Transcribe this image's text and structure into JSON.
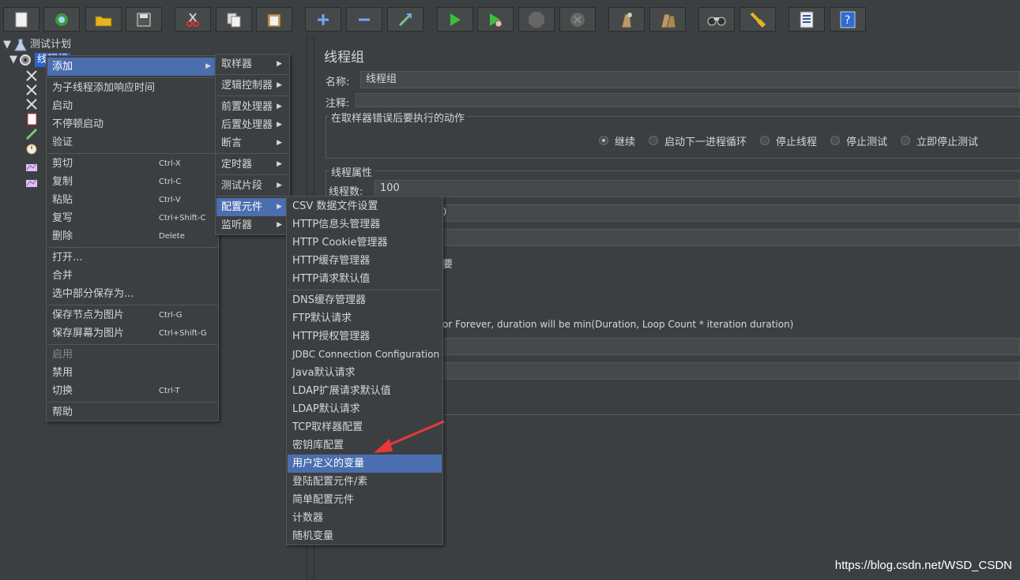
{
  "colors": {
    "bg": "#3c3f41",
    "highlight": "#4b6eaf",
    "tree_selected": "#2f65ca",
    "arrow": "#e8393a"
  },
  "toolbar": {
    "icons": [
      "new-icon",
      "templates-icon",
      "open-icon",
      "save-icon",
      "cut-icon",
      "copy-icon",
      "paste-icon",
      "expand-icon",
      "collapse-icon",
      "toggle-icon",
      "start-icon",
      "start-no-pause-icon",
      "stop-icon",
      "shutdown-icon",
      "clear-icon",
      "clear-all-icon",
      "search-icon",
      "reset-search-icon",
      "function-helper-icon",
      "help-icon"
    ]
  },
  "tree": {
    "test_plan": "测试计划",
    "thread_group": "线程组"
  },
  "panel": {
    "title": "线程组",
    "name_label": "名称:",
    "name_value": "线程组",
    "comment_label": "注释:",
    "error_group_title": "在取样器错误后要执行的动作",
    "error_options": [
      "继续",
      "启动下一进程循环",
      "停止线程",
      "停止测试",
      "立即停止测试"
    ],
    "thread_props_title": "线程属性",
    "threads_label": "线程数:",
    "threads_value": "100",
    "ramp_fragment": "0",
    "same_user_fragment": "要",
    "duration_note": "or Forever, duration will be min(Duration, Loop Count * iteration duration)"
  },
  "context_menu": {
    "items": [
      {
        "label": "添加",
        "arrow": "▶"
      },
      {
        "label": "为子线程添加响应时间"
      },
      {
        "label": "启动"
      },
      {
        "label": "不停顿启动"
      },
      {
        "label": "验证"
      },
      {
        "label": "剪切",
        "shortcut": "Ctrl-X"
      },
      {
        "label": "复制",
        "shortcut": "Ctrl-C"
      },
      {
        "label": "粘贴",
        "shortcut": "Ctrl-V"
      },
      {
        "label": "复写",
        "shortcut": "Ctrl+Shift-C"
      },
      {
        "label": "删除",
        "shortcut": "Delete"
      },
      {
        "label": "打开..."
      },
      {
        "label": "合并"
      },
      {
        "label": "选中部分保存为..."
      },
      {
        "label": "保存节点为图片",
        "shortcut": "Ctrl-G"
      },
      {
        "label": "保存屏幕为图片",
        "shortcut": "Ctrl+Shift-G"
      },
      {
        "label": "启用"
      },
      {
        "label": "禁用"
      },
      {
        "label": "切换",
        "shortcut": "Ctrl-T"
      },
      {
        "label": "帮助"
      }
    ]
  },
  "add_menu": {
    "items": [
      "取样器",
      "逻辑控制器",
      "前置处理器",
      "后置处理器",
      "断言",
      "定时器",
      "测试片段",
      "配置元件",
      "监听器"
    ],
    "arrow": "▶"
  },
  "config_menu": {
    "items": [
      "CSV 数据文件设置",
      "HTTP信息头管理器",
      "HTTP Cookie管理器",
      "HTTP缓存管理器",
      "HTTP请求默认值",
      "DNS缓存管理器",
      "FTP默认请求",
      "HTTP授权管理器",
      "JDBC Connection Configuration",
      "Java默认请求",
      "LDAP扩展请求默认值",
      "LDAP默认请求",
      "TCP取样器配置",
      "密钥库配置",
      "用户定义的变量",
      "登陆配置元件/素",
      "简单配置元件",
      "计数器",
      "随机变量"
    ]
  },
  "watermark": "https://blog.csdn.net/WSD_CSDN"
}
